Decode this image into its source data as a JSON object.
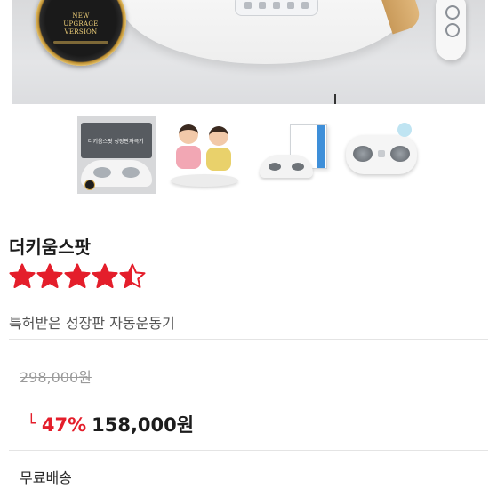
{
  "badge": {
    "line1": "NEW",
    "line2": "UPGRAGE",
    "line3": "VERSION"
  },
  "gallery": {
    "thumb1_caption": "더키움스팟 성장판자극기"
  },
  "product": {
    "name": "더키움스팟",
    "rating": 4.5,
    "rating_max": 5,
    "description": "특허받은 성장판 자동운동기"
  },
  "pricing": {
    "original_price": "298,000원",
    "discount_arrow": "└",
    "discount_rate": "47%",
    "sale_price": "158,000원"
  },
  "shipping": {
    "label": "무료배송"
  },
  "colors": {
    "star": "#e41e2b",
    "accent": "#e41e2b"
  }
}
